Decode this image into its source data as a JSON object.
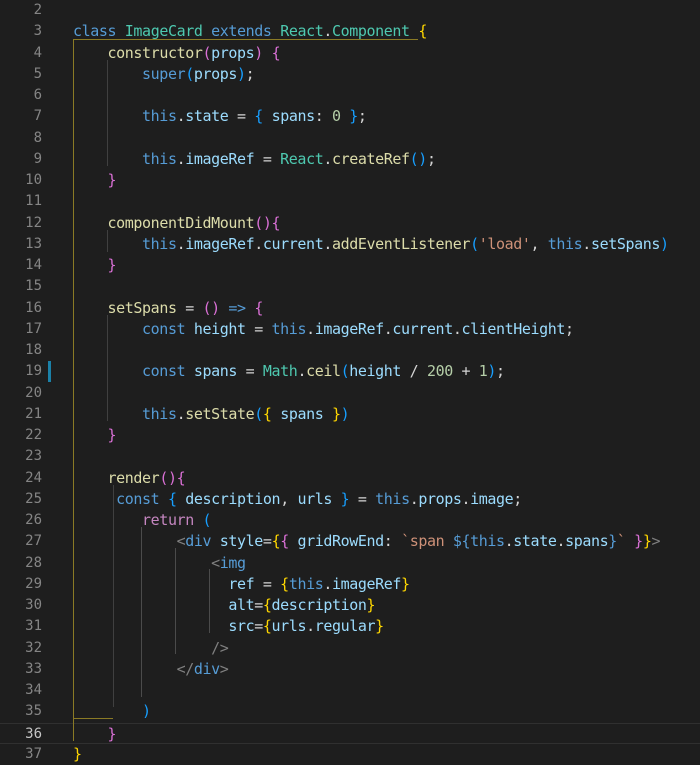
{
  "editor": {
    "language": "javascript-jsx",
    "theme_colors": {
      "background": "#1e1e1e",
      "line_number": "#858585",
      "keyword": "#569cd6",
      "class": "#4ec9b0",
      "function": "#dcdcaa",
      "variable": "#9cdcfe",
      "number": "#b5cea8",
      "string": "#ce9178",
      "bracket_1": "#ffd700",
      "bracket_2": "#da70d6",
      "bracket_3": "#179fff"
    },
    "active_line": "36",
    "modified_line": "19",
    "lines": [
      {
        "n": "2",
        "tokens": []
      },
      {
        "n": "3",
        "tokens": [
          [
            "kw",
            "class"
          ],
          [
            "pl",
            " "
          ],
          [
            "cls",
            "ImageCard"
          ],
          [
            "pl",
            " "
          ],
          [
            "kw",
            "extends"
          ],
          [
            "pl",
            " "
          ],
          [
            "cls",
            "React"
          ],
          [
            "pl",
            "."
          ],
          [
            "cls",
            "Component"
          ],
          [
            "pl",
            " "
          ],
          [
            "b1",
            "{"
          ]
        ]
      },
      {
        "n": "4",
        "tokens": [
          [
            "pl",
            "    "
          ],
          [
            "fn",
            "constructor"
          ],
          [
            "b2",
            "("
          ],
          [
            "var",
            "props"
          ],
          [
            "b2",
            ")"
          ],
          [
            "pl",
            " "
          ],
          [
            "b2",
            "{"
          ]
        ]
      },
      {
        "n": "5",
        "tokens": [
          [
            "pl",
            "        "
          ],
          [
            "kw",
            "super"
          ],
          [
            "b3",
            "("
          ],
          [
            "var",
            "props"
          ],
          [
            "b3",
            ")"
          ],
          [
            "pl",
            ";"
          ]
        ]
      },
      {
        "n": "6",
        "tokens": []
      },
      {
        "n": "7",
        "tokens": [
          [
            "pl",
            "        "
          ],
          [
            "kw",
            "this"
          ],
          [
            "pl",
            "."
          ],
          [
            "var",
            "state"
          ],
          [
            "pl",
            " = "
          ],
          [
            "b3",
            "{"
          ],
          [
            "pl",
            " "
          ],
          [
            "var",
            "spans"
          ],
          [
            "pl",
            ": "
          ],
          [
            "num",
            "0"
          ],
          [
            "pl",
            " "
          ],
          [
            "b3",
            "}"
          ],
          [
            "pl",
            ";"
          ]
        ]
      },
      {
        "n": "8",
        "tokens": []
      },
      {
        "n": "9",
        "tokens": [
          [
            "pl",
            "        "
          ],
          [
            "kw",
            "this"
          ],
          [
            "pl",
            "."
          ],
          [
            "var",
            "imageRef"
          ],
          [
            "pl",
            " = "
          ],
          [
            "cls",
            "React"
          ],
          [
            "pl",
            "."
          ],
          [
            "fn",
            "createRef"
          ],
          [
            "b3",
            "("
          ],
          [
            "b3",
            ")"
          ],
          [
            "pl",
            ";"
          ]
        ]
      },
      {
        "n": "10",
        "tokens": [
          [
            "pl",
            "    "
          ],
          [
            "b2",
            "}"
          ]
        ]
      },
      {
        "n": "11",
        "tokens": []
      },
      {
        "n": "12",
        "tokens": [
          [
            "pl",
            "    "
          ],
          [
            "fn",
            "componentDidMount"
          ],
          [
            "b2",
            "("
          ],
          [
            "b2",
            ")"
          ],
          [
            "b2",
            "{"
          ]
        ]
      },
      {
        "n": "13",
        "tokens": [
          [
            "pl",
            "        "
          ],
          [
            "kw",
            "this"
          ],
          [
            "pl",
            "."
          ],
          [
            "var",
            "imageRef"
          ],
          [
            "pl",
            "."
          ],
          [
            "var",
            "current"
          ],
          [
            "pl",
            "."
          ],
          [
            "fn",
            "addEventListener"
          ],
          [
            "b3",
            "("
          ],
          [
            "str",
            "'load'"
          ],
          [
            "pl",
            ", "
          ],
          [
            "kw",
            "this"
          ],
          [
            "pl",
            "."
          ],
          [
            "var",
            "setSpans"
          ],
          [
            "b3",
            ")"
          ]
        ]
      },
      {
        "n": "14",
        "tokens": [
          [
            "pl",
            "    "
          ],
          [
            "b2",
            "}"
          ]
        ]
      },
      {
        "n": "15",
        "tokens": []
      },
      {
        "n": "16",
        "tokens": [
          [
            "pl",
            "    "
          ],
          [
            "fn",
            "setSpans"
          ],
          [
            "pl",
            " = "
          ],
          [
            "b2",
            "("
          ],
          [
            "b2",
            ")"
          ],
          [
            "pl",
            " "
          ],
          [
            "kw",
            "=>"
          ],
          [
            "pl",
            " "
          ],
          [
            "b2",
            "{"
          ]
        ]
      },
      {
        "n": "17",
        "tokens": [
          [
            "pl",
            "        "
          ],
          [
            "kw",
            "const"
          ],
          [
            "pl",
            " "
          ],
          [
            "var",
            "height"
          ],
          [
            "pl",
            " = "
          ],
          [
            "kw",
            "this"
          ],
          [
            "pl",
            "."
          ],
          [
            "var",
            "imageRef"
          ],
          [
            "pl",
            "."
          ],
          [
            "var",
            "current"
          ],
          [
            "pl",
            "."
          ],
          [
            "var",
            "clientHeight"
          ],
          [
            "pl",
            ";"
          ]
        ]
      },
      {
        "n": "18",
        "tokens": []
      },
      {
        "n": "19",
        "tokens": [
          [
            "pl",
            "        "
          ],
          [
            "kw",
            "const"
          ],
          [
            "pl",
            " "
          ],
          [
            "var",
            "spans"
          ],
          [
            "pl",
            " = "
          ],
          [
            "cls",
            "Math"
          ],
          [
            "pl",
            "."
          ],
          [
            "fn",
            "ceil"
          ],
          [
            "b3",
            "("
          ],
          [
            "var",
            "height"
          ],
          [
            "pl",
            " / "
          ],
          [
            "num",
            "200"
          ],
          [
            "pl",
            " + "
          ],
          [
            "num",
            "1"
          ],
          [
            "b3",
            ")"
          ],
          [
            "pl",
            ";"
          ]
        ]
      },
      {
        "n": "20",
        "tokens": []
      },
      {
        "n": "21",
        "tokens": [
          [
            "pl",
            "        "
          ],
          [
            "kw",
            "this"
          ],
          [
            "pl",
            "."
          ],
          [
            "fn",
            "setState"
          ],
          [
            "b3",
            "("
          ],
          [
            "b1",
            "{"
          ],
          [
            "pl",
            " "
          ],
          [
            "var",
            "spans"
          ],
          [
            "pl",
            " "
          ],
          [
            "b1",
            "}"
          ],
          [
            "b3",
            ")"
          ]
        ]
      },
      {
        "n": "22",
        "tokens": [
          [
            "pl",
            "    "
          ],
          [
            "b2",
            "}"
          ]
        ]
      },
      {
        "n": "23",
        "tokens": []
      },
      {
        "n": "24",
        "tokens": [
          [
            "pl",
            "    "
          ],
          [
            "fn",
            "render"
          ],
          [
            "b2",
            "("
          ],
          [
            "b2",
            ")"
          ],
          [
            "b2",
            "{"
          ]
        ]
      },
      {
        "n": "25",
        "tokens": [
          [
            "pl",
            "     "
          ],
          [
            "kw",
            "const"
          ],
          [
            "pl",
            " "
          ],
          [
            "b3",
            "{"
          ],
          [
            "pl",
            " "
          ],
          [
            "var",
            "description"
          ],
          [
            "pl",
            ", "
          ],
          [
            "var",
            "urls"
          ],
          [
            "pl",
            " "
          ],
          [
            "b3",
            "}"
          ],
          [
            "pl",
            " = "
          ],
          [
            "kw",
            "this"
          ],
          [
            "pl",
            "."
          ],
          [
            "var",
            "props"
          ],
          [
            "pl",
            "."
          ],
          [
            "var",
            "image"
          ],
          [
            "pl",
            ";"
          ]
        ]
      },
      {
        "n": "26",
        "tokens": [
          [
            "pl",
            "        "
          ],
          [
            "ctl",
            "return"
          ],
          [
            "pl",
            " "
          ],
          [
            "b3",
            "("
          ]
        ]
      },
      {
        "n": "27",
        "tokens": [
          [
            "pl",
            "            "
          ],
          [
            "tag",
            "<"
          ],
          [
            "tn",
            "div"
          ],
          [
            "pl",
            " "
          ],
          [
            "var",
            "style"
          ],
          [
            "pl",
            "="
          ],
          [
            "b1",
            "{"
          ],
          [
            "b2",
            "{"
          ],
          [
            "pl",
            " "
          ],
          [
            "var",
            "gridRowEnd"
          ],
          [
            "pl",
            ": "
          ],
          [
            "str",
            "`span "
          ],
          [
            "kw",
            "${"
          ],
          [
            "kw",
            "this"
          ],
          [
            "pl",
            "."
          ],
          [
            "var",
            "state"
          ],
          [
            "pl",
            "."
          ],
          [
            "var",
            "spans"
          ],
          [
            "kw",
            "}"
          ],
          [
            "str",
            "`"
          ],
          [
            "pl",
            " "
          ],
          [
            "b2",
            "}"
          ],
          [
            "b1",
            "}"
          ],
          [
            "tag",
            ">"
          ]
        ]
      },
      {
        "n": "28",
        "tokens": [
          [
            "pl",
            "                "
          ],
          [
            "tag",
            "<"
          ],
          [
            "tn",
            "img"
          ]
        ]
      },
      {
        "n": "29",
        "tokens": [
          [
            "pl",
            "                  "
          ],
          [
            "var",
            "ref"
          ],
          [
            "pl",
            " = "
          ],
          [
            "b1",
            "{"
          ],
          [
            "kw",
            "this"
          ],
          [
            "pl",
            "."
          ],
          [
            "var",
            "imageRef"
          ],
          [
            "b1",
            "}"
          ]
        ]
      },
      {
        "n": "30",
        "tokens": [
          [
            "pl",
            "                  "
          ],
          [
            "var",
            "alt"
          ],
          [
            "pl",
            "="
          ],
          [
            "b1",
            "{"
          ],
          [
            "var",
            "description"
          ],
          [
            "b1",
            "}"
          ]
        ]
      },
      {
        "n": "31",
        "tokens": [
          [
            "pl",
            "                  "
          ],
          [
            "var",
            "src"
          ],
          [
            "pl",
            "="
          ],
          [
            "b1",
            "{"
          ],
          [
            "var",
            "urls"
          ],
          [
            "pl",
            "."
          ],
          [
            "var",
            "regular"
          ],
          [
            "b1",
            "}"
          ]
        ]
      },
      {
        "n": "32",
        "tokens": [
          [
            "pl",
            "                "
          ],
          [
            "tag",
            "/>"
          ]
        ]
      },
      {
        "n": "33",
        "tokens": [
          [
            "pl",
            "            "
          ],
          [
            "tag",
            "</"
          ],
          [
            "tn",
            "div"
          ],
          [
            "tag",
            ">"
          ]
        ]
      },
      {
        "n": "34",
        "tokens": []
      },
      {
        "n": "35",
        "tokens": [
          [
            "pl",
            "        "
          ],
          [
            "b3",
            ")"
          ]
        ]
      },
      {
        "n": "36",
        "tokens": [
          [
            "pl",
            "    "
          ],
          [
            "b2",
            "}"
          ]
        ]
      },
      {
        "n": "37",
        "tokens": [
          [
            "b1",
            "}"
          ]
        ]
      }
    ]
  }
}
